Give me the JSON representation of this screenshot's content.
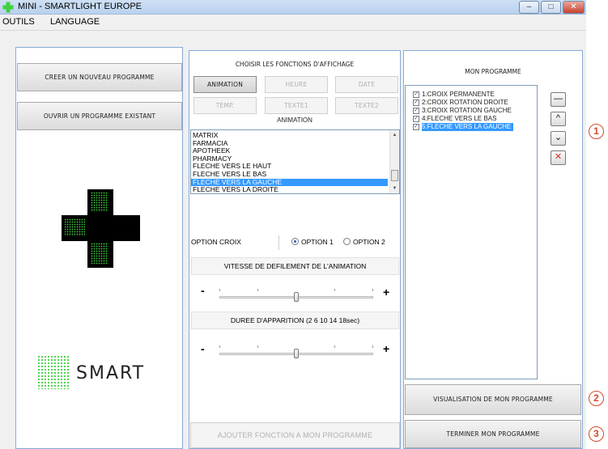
{
  "window": {
    "title": "MINI  - SMARTLIGHT EUROPE",
    "minimize": "–",
    "maximize": "□",
    "close": "✕"
  },
  "menu": {
    "items": [
      "OUTILS",
      "LANGUAGE"
    ]
  },
  "left": {
    "create_button": "CREER UN NOUVEAU PROGRAMME",
    "open_button": "OUVRIR UN PROGRAMME EXISTANT",
    "logo_text": "SMART"
  },
  "center": {
    "section_title": "CHOISIR LES FONCTIONS D'AFFICHAGE",
    "function_buttons": [
      "ANIMATION",
      "HEURE",
      "DATE",
      "TEMP.",
      "TEXTE1",
      "TEXTE2"
    ],
    "selected_function": "ANIMATION",
    "current_label": "ANIMATION",
    "animation_list": [
      "MATRIX",
      "FARMACIA",
      "APOTHEEK",
      "PHARMACY",
      "FLECHE VERS LE HAUT",
      "FLECHE VERS LE BAS",
      "FLECHE VERS LA GAUCHE",
      "FLECHE VERS LA DROITE"
    ],
    "selected_animation": "FLECHE VERS LA GAUCHE",
    "option_croix_label": "OPTION CROIX",
    "option1_label": "OPTION 1",
    "option2_label": "OPTION 2",
    "selected_option": "OPTION 1",
    "speed_label": "VITESSE DE DEFILEMENT DE L'ANIMATION",
    "speed_minus": "-",
    "speed_plus": "+",
    "speed_level": 0.5,
    "duration_label": "DUREE D'APPARITION (2 6 10 14 18sec)",
    "duration_minus": "-",
    "duration_plus": "+",
    "duration_level": 0.5,
    "add_button": "AJOUTER FONCTION A MON PROGRAMME"
  },
  "right": {
    "title": "MON PROGRAMME",
    "program_items": [
      "1:CROIX PERMANENTE",
      "2:CROIX ROTATION DROITE",
      "3:CROIX ROTATION GAUCHE",
      "4:FLECHE VERS LE BAS",
      "5:FLECHE VERS LA GAUCHE"
    ],
    "selected_item": "5:FLECHE VERS LA GAUCHE",
    "visualize_button": "VISUALISATION DE MON PROGRAMME",
    "finish_button": "TERMINER MON PROGRAMME",
    "side_buttons": {
      "remove": "—",
      "up": "^",
      "down": "⌄",
      "delete": "✕"
    }
  },
  "callouts": [
    "1",
    "2",
    "3"
  ],
  "colors": {
    "accent_blue": "#3399ff",
    "cross_green": "#3fd13f",
    "callout_red": "#d24a2a",
    "delete_red": "#d8281e"
  }
}
